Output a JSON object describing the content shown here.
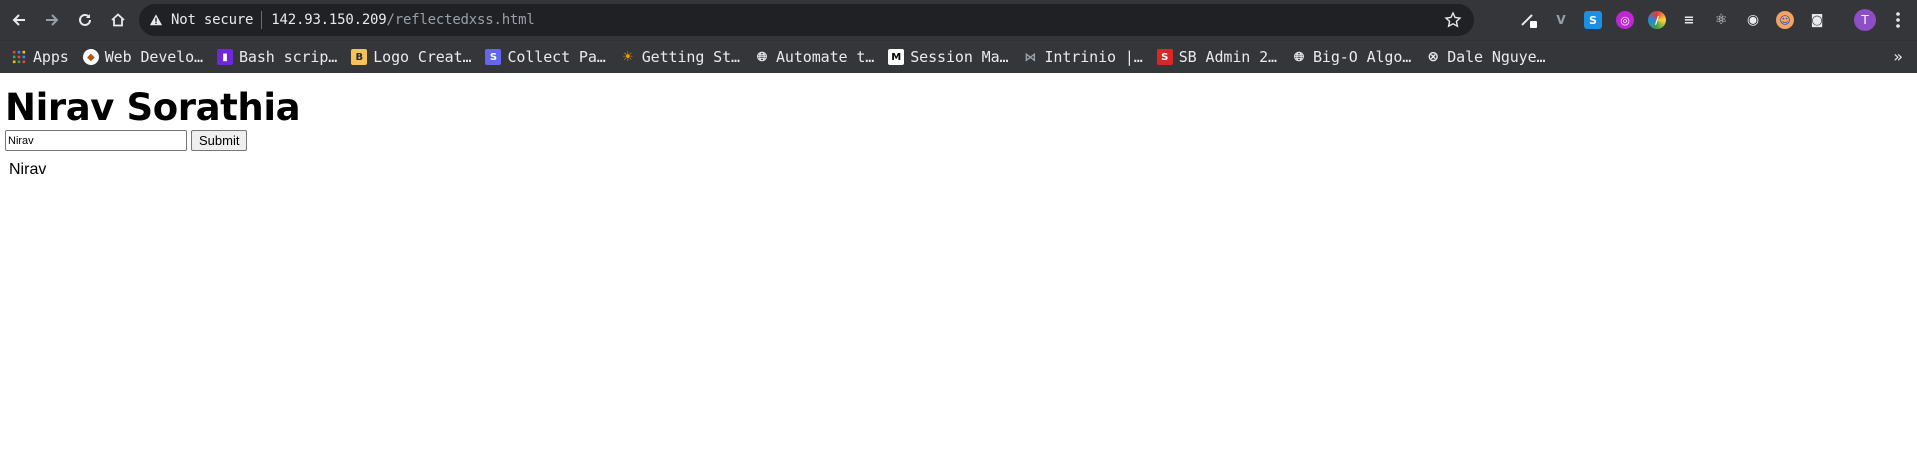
{
  "browser": {
    "nav": {
      "back": "back-arrow-icon",
      "forward": "forward-arrow-icon",
      "reload": "reload-icon",
      "home": "home-icon"
    },
    "omnibox": {
      "security_label": "Not secure",
      "url_host": "142.93.150.209",
      "url_path": "/reflectedxss.html"
    },
    "profile_initial": "T",
    "bookmarks": [
      {
        "label": "Apps",
        "icon": "apps-grid-icon"
      },
      {
        "label": "Web Develo…",
        "icon": "bulb-icon"
      },
      {
        "label": "Bash scrip…",
        "icon": "bash-icon"
      },
      {
        "label": "Logo Creat…",
        "icon": "logo-b-icon"
      },
      {
        "label": "Collect Pa…",
        "icon": "collect-s-icon"
      },
      {
        "label": "Getting St…",
        "icon": "sun-icon"
      },
      {
        "label": "Automate t…",
        "icon": "globe-icon"
      },
      {
        "label": "Session Ma…",
        "icon": "medium-m-icon"
      },
      {
        "label": "Intrinio |…",
        "icon": "intrinio-icon"
      },
      {
        "label": "SB Admin 2…",
        "icon": "sb-admin-icon"
      },
      {
        "label": "Big-O Algo…",
        "icon": "globe-icon"
      },
      {
        "label": "Dale Nguye…",
        "icon": "circle-x-icon"
      }
    ],
    "overflow": "»"
  },
  "page": {
    "title": "Nirav Sorathia",
    "input_value": "Nirav",
    "submit_label": "Submit",
    "output_text": "Nirav"
  },
  "colors": {
    "toolbar_bg": "#35363a",
    "omnibox_bg": "#202124",
    "profile_bg": "#8e4ec6"
  }
}
